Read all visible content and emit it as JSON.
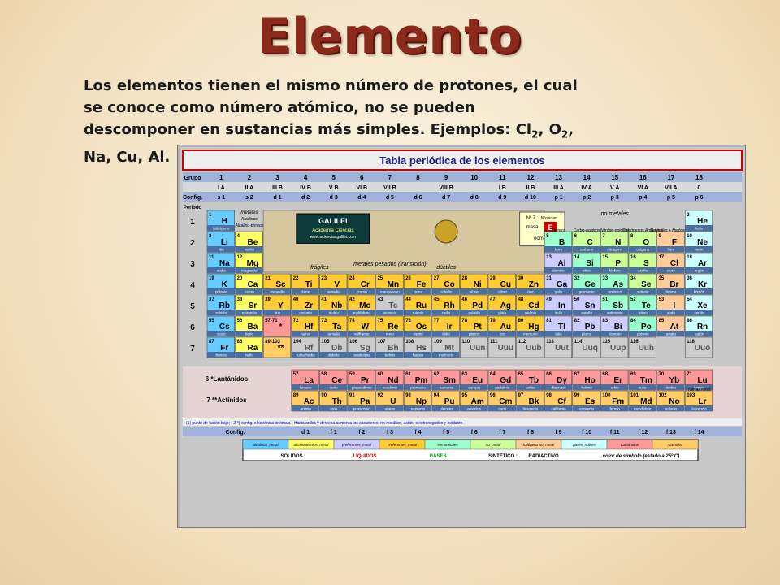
{
  "slide": {
    "title": "Elemento",
    "intro_main": "Los elementos tienen el mismo número de protones, el cual se conoce como número atómico, no se pueden descomponer en sustancias más simples.  Ejemplos:  ",
    "example_cl": "Cl",
    "example_cl_sub": "2",
    "example_sep": ", ",
    "example_o": "O",
    "example_o_sub": "2",
    "example_tail": ", Na, Cu, Al."
  },
  "table": {
    "title": "Tabla periódica de los elementos",
    "row_labels": {
      "grupo": "Grupo",
      "config": "Config.",
      "periodo": "Período"
    },
    "groups": [
      "1",
      "2",
      "3",
      "4",
      "5",
      "6",
      "7",
      "8",
      "9",
      "10",
      "11",
      "12",
      "13",
      "14",
      "15",
      "16",
      "17",
      "18"
    ],
    "roman_groups": [
      "I A",
      "II A",
      "III B",
      "IV B",
      "V B",
      "VI B",
      "VII B",
      "VIII B",
      "I B",
      "II B",
      "III A",
      "IV A",
      "V A",
      "VI A",
      "VII A",
      "0"
    ],
    "configs": [
      "s 1",
      "s 2",
      "d 1",
      "d 2",
      "d 3",
      "d 4",
      "d 5",
      "d 6",
      "d 7",
      "d 8",
      "d 9",
      "d 10",
      "p 1",
      "p 2",
      "p 3",
      "p 4",
      "p 5",
      "p 6"
    ],
    "periods": [
      "1",
      "2",
      "3",
      "4",
      "5",
      "6",
      "7"
    ],
    "labels": {
      "metales": "metales",
      "no_metales": "no metales",
      "metales_pesados": "metales pesados (transición)",
      "fragiles": "frágiles",
      "ductiles": "dúctiles",
      "galilei": "GALILEI",
      "academia": "Academia Ciencias",
      "web": "www.acienciasgalilei.com",
      "key_z": "Nº Z",
      "key_ox": "Nºoxidac.",
      "key_masa": "masa",
      "key_e": "E",
      "key_nombre": "nombre",
      "terreos": "Térreos",
      "carbonoideos": "Carbo-noideos",
      "nitrogenoideos": "Nitróge-noideos",
      "calcogenos": "Calcógenos Anfígenos",
      "halogenos": "G.Nobles + Halógenos",
      "alcalinos": "Alcalinos",
      "alcalino_terreos": "Alcalino-térreos",
      "lantanidos": "6  *Lantánidos",
      "actinidos": "7  **Actínidos",
      "tierras_raras": "Tierras raras",
      "footnote": "(1) punto de fusión bajo; ( Z *) config. electrónica anómala ; Hacia arriba y derecha aumenta los caracteres: no metálico, ácido, electronegativo y oxidante.",
      "config_bottom": "Config.",
      "sixty": "57-71",
      "eighty": "89-103"
    },
    "f_configs": [
      "d 1",
      "f 1",
      "f 2",
      "f 3",
      "f 4",
      "f 5",
      "f 6",
      "f 7",
      "f 8",
      "f 9",
      "f 10",
      "f 11",
      "f 12",
      "f 13",
      "f 14"
    ],
    "legend": {
      "row1": [
        "alcalinos_metal",
        "alcalinotérreos_metal",
        "preferentes_metal",
        "preferentes_metal",
        "semimetales",
        "no_metal",
        "halógeno-no_metal",
        "gases_nobles",
        "Lantánidos",
        "Actínidos"
      ],
      "solidos": "SÓLIDOS",
      "liquidos": "LÍQUIDOS",
      "gases": "GASES",
      "sintetico": "SINTÉTICO :",
      "radiactivo": "RADIACTIVO",
      "color_simbolo": "color de símbolo (estado a 25º C)"
    },
    "colors": {
      "alcalino": "#66ccff",
      "alcalinoterreo": "#ffff66",
      "transicion": "#ffcc33",
      "semimetal": "#99ffcc",
      "nometal": "#ccff99",
      "halogeno": "#ffcc99",
      "gasnoble": "#ccffff",
      "otrometal": "#ccccff",
      "lantanido": "#ff9999",
      "actinido": "#ffcc66",
      "sintetico": "#cccccc"
    },
    "elements": [
      {
        "z": "1",
        "s": "H",
        "n": "hidrógeno",
        "c": "alcalino"
      },
      {
        "z": "2",
        "s": "He",
        "n": "helio",
        "c": "gasnoble"
      },
      {
        "z": "3",
        "s": "Li",
        "n": "litio",
        "c": "alcalino"
      },
      {
        "z": "4",
        "s": "Be",
        "n": "berilio",
        "c": "alcalinoterreo"
      },
      {
        "z": "5",
        "s": "B",
        "n": "boro",
        "c": "semimetal"
      },
      {
        "z": "6",
        "s": "C",
        "n": "carbono",
        "c": "nometal"
      },
      {
        "z": "7",
        "s": "N",
        "n": "nitrógeno",
        "c": "nometal"
      },
      {
        "z": "8",
        "s": "O",
        "n": "oxígeno",
        "c": "nometal"
      },
      {
        "z": "9",
        "s": "F",
        "n": "flúor",
        "c": "halogeno"
      },
      {
        "z": "10",
        "s": "Ne",
        "n": "neón",
        "c": "gasnoble"
      },
      {
        "z": "11",
        "s": "Na",
        "n": "sodio",
        "c": "alcalino"
      },
      {
        "z": "12",
        "s": "Mg",
        "n": "magnesio",
        "c": "alcalinoterreo"
      },
      {
        "z": "13",
        "s": "Al",
        "n": "aluminio",
        "c": "otrometal"
      },
      {
        "z": "14",
        "s": "Si",
        "n": "silicio",
        "c": "semimetal"
      },
      {
        "z": "15",
        "s": "P",
        "n": "fósforo",
        "c": "nometal"
      },
      {
        "z": "16",
        "s": "S",
        "n": "azufre",
        "c": "nometal"
      },
      {
        "z": "17",
        "s": "Cl",
        "n": "cloro",
        "c": "halogeno"
      },
      {
        "z": "18",
        "s": "Ar",
        "n": "argón",
        "c": "gasnoble"
      },
      {
        "z": "19",
        "s": "K",
        "n": "potasio",
        "c": "alcalino"
      },
      {
        "z": "20",
        "s": "Ca",
        "n": "calcio",
        "c": "alcalinoterreo"
      },
      {
        "z": "21",
        "s": "Sc",
        "n": "escandio",
        "c": "transicion"
      },
      {
        "z": "22",
        "s": "Ti",
        "n": "titanio",
        "c": "transicion"
      },
      {
        "z": "23",
        "s": "V",
        "n": "vanadio",
        "c": "transicion"
      },
      {
        "z": "24",
        "s": "Cr",
        "n": "cromo",
        "c": "transicion"
      },
      {
        "z": "25",
        "s": "Mn",
        "n": "manganeso",
        "c": "transicion"
      },
      {
        "z": "26",
        "s": "Fe",
        "n": "hierro",
        "c": "transicion"
      },
      {
        "z": "27",
        "s": "Co",
        "n": "cobalto",
        "c": "transicion"
      },
      {
        "z": "28",
        "s": "Ni",
        "n": "níquel",
        "c": "transicion"
      },
      {
        "z": "29",
        "s": "Cu",
        "n": "cobre",
        "c": "transicion"
      },
      {
        "z": "30",
        "s": "Zn",
        "n": "cinc",
        "c": "transicion"
      },
      {
        "z": "31",
        "s": "Ga",
        "n": "galio",
        "c": "otrometal"
      },
      {
        "z": "32",
        "s": "Ge",
        "n": "germanio",
        "c": "semimetal"
      },
      {
        "z": "33",
        "s": "As",
        "n": "arsénico",
        "c": "semimetal"
      },
      {
        "z": "34",
        "s": "Se",
        "n": "selenio",
        "c": "nometal"
      },
      {
        "z": "35",
        "s": "Br",
        "n": "bromo",
        "c": "halogeno"
      },
      {
        "z": "36",
        "s": "Kr",
        "n": "kriptón",
        "c": "gasnoble"
      },
      {
        "z": "37",
        "s": "Rb",
        "n": "rubidio",
        "c": "alcalino"
      },
      {
        "z": "38",
        "s": "Sr",
        "n": "estroncio",
        "c": "alcalinoterreo"
      },
      {
        "z": "39",
        "s": "Y",
        "n": "itrio",
        "c": "transicion"
      },
      {
        "z": "40",
        "s": "Zr",
        "n": "circonio",
        "c": "transicion"
      },
      {
        "z": "41",
        "s": "Nb",
        "n": "niobio",
        "c": "transicion"
      },
      {
        "z": "42",
        "s": "Mo",
        "n": "molibdeno",
        "c": "transicion"
      },
      {
        "z": "43",
        "s": "Tc",
        "n": "tecnecio",
        "c": "sintetico"
      },
      {
        "z": "44",
        "s": "Ru",
        "n": "rutenio",
        "c": "transicion"
      },
      {
        "z": "45",
        "s": "Rh",
        "n": "rodio",
        "c": "transicion"
      },
      {
        "z": "46",
        "s": "Pd",
        "n": "paladio",
        "c": "transicion"
      },
      {
        "z": "47",
        "s": "Ag",
        "n": "plata",
        "c": "transicion"
      },
      {
        "z": "48",
        "s": "Cd",
        "n": "cadmio",
        "c": "transicion"
      },
      {
        "z": "49",
        "s": "In",
        "n": "indio",
        "c": "otrometal"
      },
      {
        "z": "50",
        "s": "Sn",
        "n": "estaño",
        "c": "otrometal"
      },
      {
        "z": "51",
        "s": "Sb",
        "n": "antimonio",
        "c": "semimetal"
      },
      {
        "z": "52",
        "s": "Te",
        "n": "teluro",
        "c": "semimetal"
      },
      {
        "z": "53",
        "s": "I",
        "n": "yodo",
        "c": "halogeno"
      },
      {
        "z": "54",
        "s": "Xe",
        "n": "xenón",
        "c": "gasnoble"
      },
      {
        "z": "55",
        "s": "Cs",
        "n": "cesio",
        "c": "alcalino"
      },
      {
        "z": "56",
        "s": "Ba",
        "n": "bario",
        "c": "alcalinoterreo"
      },
      {
        "z": "57-71",
        "s": "*",
        "n": "",
        "c": "lantanido"
      },
      {
        "z": "72",
        "s": "Hf",
        "n": "hafnio",
        "c": "transicion"
      },
      {
        "z": "73",
        "s": "Ta",
        "n": "tantalio",
        "c": "transicion"
      },
      {
        "z": "74",
        "s": "W",
        "n": "volframio",
        "c": "transicion"
      },
      {
        "z": "75",
        "s": "Re",
        "n": "renio",
        "c": "transicion"
      },
      {
        "z": "76",
        "s": "Os",
        "n": "osmio",
        "c": "transicion"
      },
      {
        "z": "77",
        "s": "Ir",
        "n": "iridio",
        "c": "transicion"
      },
      {
        "z": "78",
        "s": "Pt",
        "n": "platino",
        "c": "transicion"
      },
      {
        "z": "79",
        "s": "Au",
        "n": "oro",
        "c": "transicion"
      },
      {
        "z": "80",
        "s": "Hg",
        "n": "mercurio",
        "c": "transicion"
      },
      {
        "z": "81",
        "s": "Tl",
        "n": "talio",
        "c": "otrometal"
      },
      {
        "z": "82",
        "s": "Pb",
        "n": "plomo",
        "c": "otrometal"
      },
      {
        "z": "83",
        "s": "Bi",
        "n": "bismuto",
        "c": "otrometal"
      },
      {
        "z": "84",
        "s": "Po",
        "n": "polonio",
        "c": "semimetal"
      },
      {
        "z": "85",
        "s": "At",
        "n": "astato",
        "c": "halogeno"
      },
      {
        "z": "86",
        "s": "Rn",
        "n": "radón",
        "c": "gasnoble"
      },
      {
        "z": "87",
        "s": "Fr",
        "n": "francio",
        "c": "alcalino"
      },
      {
        "z": "88",
        "s": "Ra",
        "n": "radio",
        "c": "alcalinoterreo"
      },
      {
        "z": "89-103",
        "s": "**",
        "n": "",
        "c": "actinido"
      },
      {
        "z": "104",
        "s": "Rf",
        "n": "rutherfordio",
        "c": "sintetico"
      },
      {
        "z": "105",
        "s": "Db",
        "n": "dubnio",
        "c": "sintetico"
      },
      {
        "z": "106",
        "s": "Sg",
        "n": "seaborgio",
        "c": "sintetico"
      },
      {
        "z": "107",
        "s": "Bh",
        "n": "bohrio",
        "c": "sintetico"
      },
      {
        "z": "108",
        "s": "Hs",
        "n": "hassio",
        "c": "sintetico"
      },
      {
        "z": "109",
        "s": "Mt",
        "n": "meitnerio",
        "c": "sintetico"
      },
      {
        "z": "110",
        "s": "Uun",
        "n": "",
        "c": "sintetico"
      },
      {
        "z": "111",
        "s": "Uuu",
        "n": "",
        "c": "sintetico"
      },
      {
        "z": "112",
        "s": "Uub",
        "n": "",
        "c": "sintetico"
      },
      {
        "z": "113",
        "s": "Uut",
        "n": "",
        "c": "sintetico"
      },
      {
        "z": "114",
        "s": "Uuq",
        "n": "",
        "c": "sintetico"
      },
      {
        "z": "115",
        "s": "Uup",
        "n": "",
        "c": "sintetico"
      },
      {
        "z": "116",
        "s": "Uuh",
        "n": "",
        "c": "sintetico"
      },
      {
        "z": "118",
        "s": "Uuo",
        "n": "",
        "c": "sintetico"
      }
    ],
    "lanthanides": [
      {
        "z": "57",
        "s": "La",
        "n": "lantano"
      },
      {
        "z": "58",
        "s": "Ce",
        "n": "cerio"
      },
      {
        "z": "59",
        "s": "Pr",
        "n": "praseodimio"
      },
      {
        "z": "60",
        "s": "Nd",
        "n": "neodimio"
      },
      {
        "z": "61",
        "s": "Pm",
        "n": "promecio"
      },
      {
        "z": "62",
        "s": "Sm",
        "n": "samario"
      },
      {
        "z": "63",
        "s": "Eu",
        "n": "europio"
      },
      {
        "z": "64",
        "s": "Gd",
        "n": "gadolinio"
      },
      {
        "z": "65",
        "s": "Tb",
        "n": "terbio"
      },
      {
        "z": "66",
        "s": "Dy",
        "n": "disprosio"
      },
      {
        "z": "67",
        "s": "Ho",
        "n": "holmio"
      },
      {
        "z": "68",
        "s": "Er",
        "n": "erbio"
      },
      {
        "z": "69",
        "s": "Tm",
        "n": "tulio"
      },
      {
        "z": "70",
        "s": "Yb",
        "n": "iterbio"
      },
      {
        "z": "71",
        "s": "Lu",
        "n": "lutecio"
      }
    ],
    "actinides": [
      {
        "z": "89",
        "s": "Ac",
        "n": "actinio"
      },
      {
        "z": "90",
        "s": "Th",
        "n": "torio"
      },
      {
        "z": "91",
        "s": "Pa",
        "n": "protactinio"
      },
      {
        "z": "92",
        "s": "U",
        "n": "uranio"
      },
      {
        "z": "93",
        "s": "Np",
        "n": "neptunio"
      },
      {
        "z": "94",
        "s": "Pu",
        "n": "plutonio"
      },
      {
        "z": "95",
        "s": "Am",
        "n": "americio"
      },
      {
        "z": "96",
        "s": "Cm",
        "n": "curio"
      },
      {
        "z": "97",
        "s": "Bk",
        "n": "berquelio"
      },
      {
        "z": "98",
        "s": "Cf",
        "n": "californio"
      },
      {
        "z": "99",
        "s": "Es",
        "n": "einstenio"
      },
      {
        "z": "100",
        "s": "Fm",
        "n": "fermio"
      },
      {
        "z": "101",
        "s": "Md",
        "n": "mendelevio"
      },
      {
        "z": "102",
        "s": "No",
        "n": "nobelio"
      },
      {
        "z": "103",
        "s": "Lr",
        "n": "laurencio"
      }
    ]
  }
}
